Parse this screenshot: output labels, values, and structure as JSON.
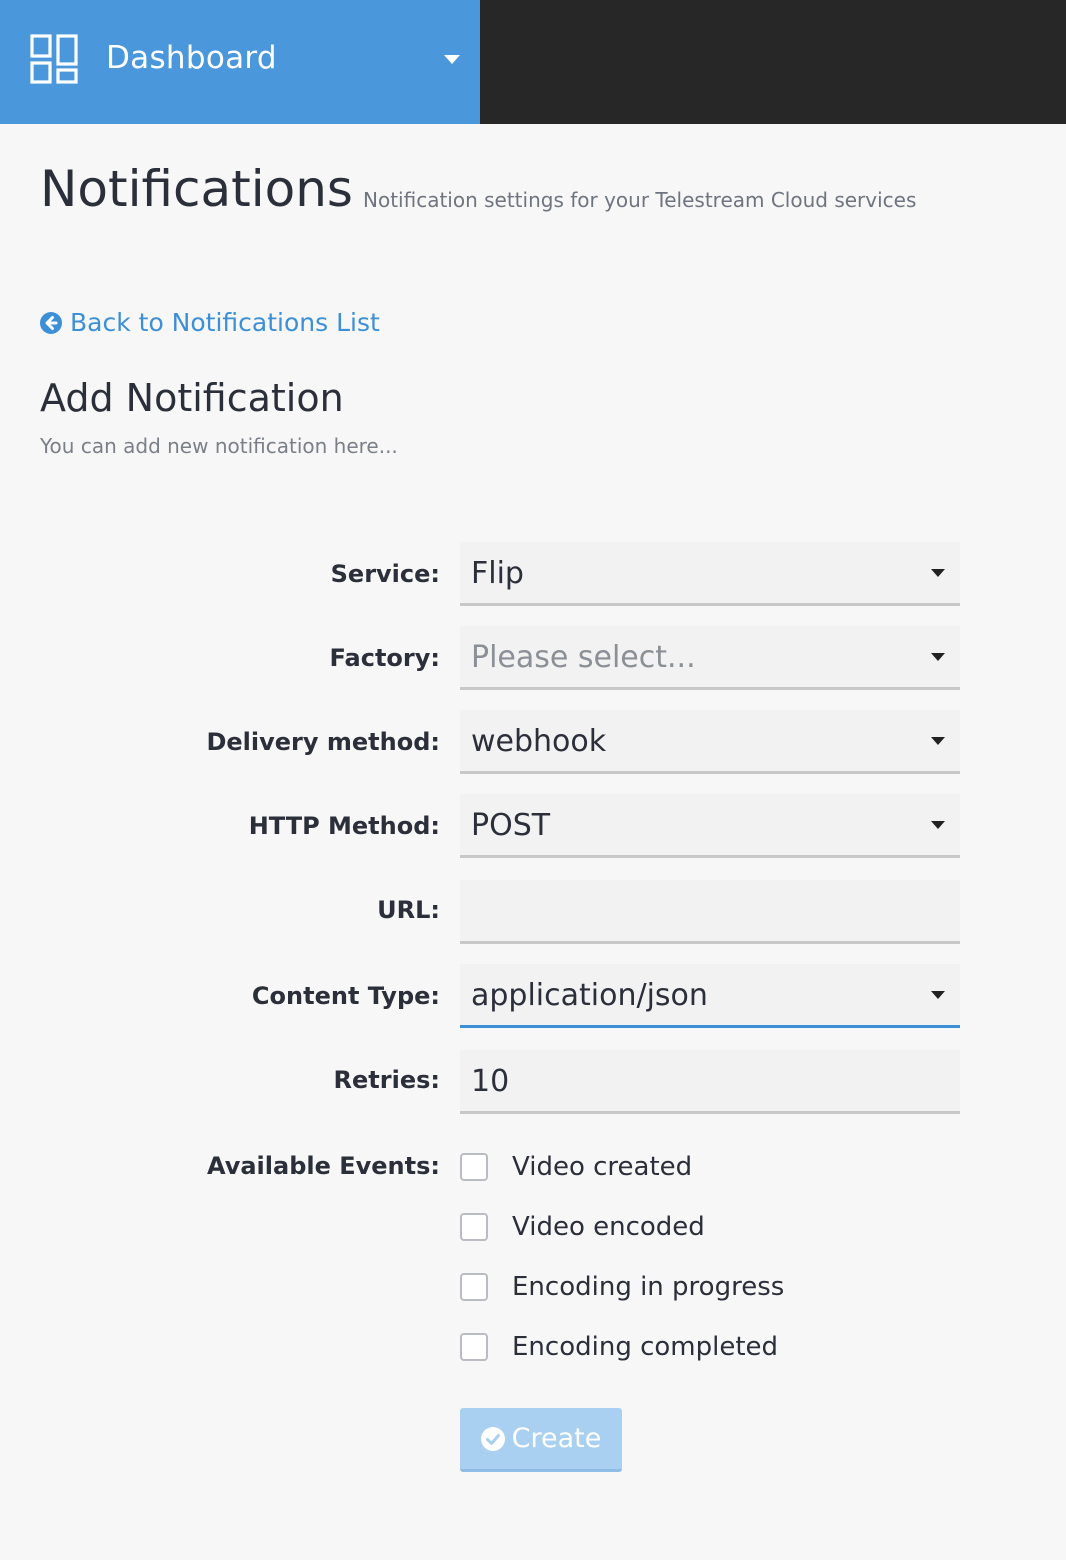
{
  "header": {
    "dashboard_label": "Dashboard",
    "accent_color": "#4a98db",
    "bar_color": "#272727"
  },
  "page": {
    "title": "Notifications",
    "subtitle": "Notification settings for your Telestream Cloud services"
  },
  "back_link": {
    "label": "Back to Notifications List",
    "icon": "arrow-left-circle-icon"
  },
  "section": {
    "title": "Add Notification",
    "subtitle": "You can add new notification here..."
  },
  "form": {
    "service": {
      "label": "Service:",
      "value": "Flip"
    },
    "factory": {
      "label": "Factory:",
      "value": "Please select..."
    },
    "delivery_method": {
      "label": "Delivery method:",
      "value": "webhook"
    },
    "http_method": {
      "label": "HTTP Method:",
      "value": "POST"
    },
    "url": {
      "label": "URL:",
      "value": ""
    },
    "content_type": {
      "label": "Content Type:",
      "value": "application/json"
    },
    "retries": {
      "label": "Retries:",
      "value": "10"
    },
    "events": {
      "label": "Available Events:",
      "items": [
        {
          "label": "Video created",
          "checked": false
        },
        {
          "label": "Video encoded",
          "checked": false
        },
        {
          "label": "Encoding in progress",
          "checked": false
        },
        {
          "label": "Encoding completed",
          "checked": false
        }
      ]
    },
    "create_button": {
      "label": "Create",
      "icon": "check-circle-icon",
      "disabled": true
    }
  }
}
